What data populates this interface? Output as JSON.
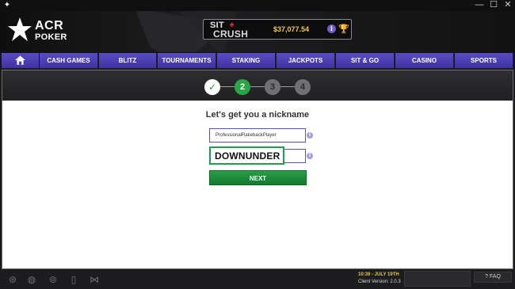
{
  "window": {
    "minimize": "—",
    "maximize": "☐",
    "close": "✕"
  },
  "brand": {
    "line1": "ACR",
    "line2": "POKER"
  },
  "promo": {
    "sit": "SIT",
    "crush": "CRUSH",
    "amount": "$37,077.54",
    "info": "i"
  },
  "nav": {
    "items": [
      {
        "label": "CASH GAMES"
      },
      {
        "label": "BLITZ"
      },
      {
        "label": "TOURNAMENTS"
      },
      {
        "label": "STAKING"
      },
      {
        "label": "JACKPOTS"
      },
      {
        "label": "SIT & GO"
      },
      {
        "label": "CASINO"
      },
      {
        "label": "SPORTS"
      }
    ]
  },
  "stepper": {
    "steps": [
      {
        "label": "✓",
        "state": "done"
      },
      {
        "label": "2",
        "state": "active"
      },
      {
        "label": "3",
        "state": "pending"
      },
      {
        "label": "4",
        "state": "pending"
      }
    ]
  },
  "form": {
    "heading": "Let's get you a nickname",
    "field1_value": "ProfessionalRakebackPlayer",
    "field2_value": "DOWNUNDER",
    "info": "i",
    "next_label": "NEXT"
  },
  "footer": {
    "time": "10:39 - JULY 19TH",
    "version": "Client Version: 2.0.3",
    "faq": "FAQ"
  },
  "colors": {
    "nav_purple": "#4a3db3",
    "accent_green": "#2aa649",
    "gold": "#f1c84b",
    "highlight_green": "#1e9f4a"
  }
}
